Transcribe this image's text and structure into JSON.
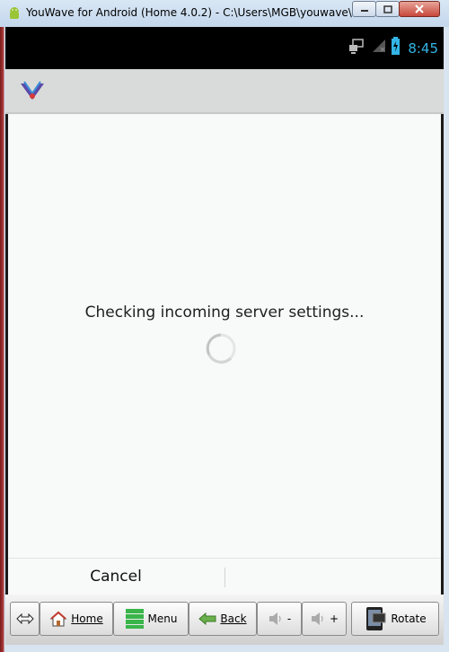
{
  "window": {
    "title": "YouWave for Android (Home 4.0.2) - C:\\Users\\MGB\\youwave\\"
  },
  "statusbar": {
    "time": "8:45",
    "icons": [
      "screen-share-icon",
      "signal-icon",
      "battery-charging-icon"
    ]
  },
  "actionbar": {
    "app_icon": "email-app-icon"
  },
  "content": {
    "progress_message": "Checking incoming server settings...",
    "spinner": "loading-spinner-icon"
  },
  "footer": {
    "cancel_label": "Cancel"
  },
  "toolbar": {
    "rotate_left_icon": "arrow-both-icon",
    "home_label": "Home",
    "menu_label": "Menu",
    "back_label": "Back",
    "volume_down_label": "-",
    "volume_up_label": "+",
    "rotate_label": "Rotate"
  },
  "colors": {
    "status_time": "#33b5e5",
    "actionbar_bg": "#d8dbd9",
    "content_bg": "#f7faf8",
    "statusbar_bg": "#000000"
  }
}
